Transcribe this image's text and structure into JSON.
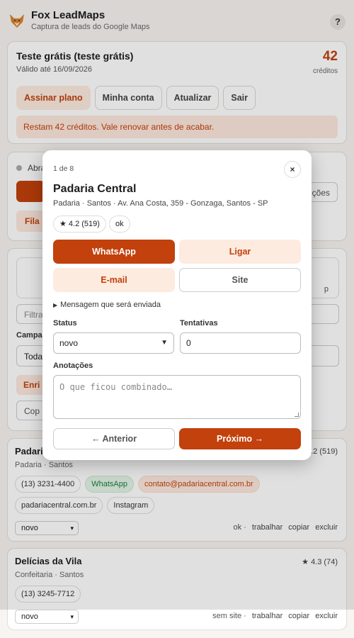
{
  "header": {
    "title": "Fox LeadMaps",
    "subtitle": "Captura de leads do Google Maps",
    "help_label": "?"
  },
  "plan": {
    "name": "Teste grátis (teste grátis)",
    "valid_until": "Válido até 16/09/2026",
    "credits": "42",
    "credits_label": "créditos",
    "buttons": {
      "subscribe": "Assinar plano",
      "account": "Minha conta",
      "refresh": "Atualizar",
      "logout": "Sair"
    },
    "warning": "Restam 42 créditos. Vale renovar antes de acabar."
  },
  "background": {
    "card2_label": "Abra",
    "options_label": "ções",
    "queue_label": "Fila",
    "box_partial": "p",
    "filter_placeholder": "Filtra",
    "campaign_label": "Campa",
    "select_value": "Toda",
    "enrich_label": "Enri",
    "copy_label": "Cop"
  },
  "leads": [
    {
      "name": "Padari",
      "rating": ".2 (519)",
      "category": "Padaria · Santos",
      "phone": "(13) 3231-4400",
      "whatsapp": "WhatsApp",
      "email": "contato@padariacentral.com.br",
      "site": "padariacentral.com.br",
      "instagram": "Instagram",
      "status": "novo",
      "flag": "ok ·",
      "actions": {
        "work": "trabalhar",
        "copy": "copiar",
        "delete": "excluir"
      }
    },
    {
      "name": "Delícias da Vila",
      "rating": "★ 4.3 (74)",
      "category": "Confeitaria · Santos",
      "phone": "(13) 3245-7712",
      "status": "novo",
      "flag": "sem site ·",
      "actions": {
        "work": "trabalhar",
        "copy": "copiar",
        "delete": "excluir"
      }
    }
  ],
  "modal": {
    "counter": "1 de 8",
    "close_label": "×",
    "title": "Padaria Central",
    "subtitle": "Padaria · Santos · Av. Ana Costa, 359 - Gonzaga, Santos - SP",
    "rating_chip": "★ 4.2 (519)",
    "status_chip": "ok",
    "buttons": {
      "whatsapp": "WhatsApp",
      "call": "Ligar",
      "email": "E-mail",
      "site": "Site"
    },
    "message_summary": "Mensagem que será enviada",
    "status_label": "Status",
    "status_value": "novo",
    "attempts_label": "Tentativas",
    "attempts_value": "0",
    "notes_label": "Anotações",
    "notes_placeholder": "O que ficou combinado…",
    "prev_label": "← Anterior",
    "next_label": "Próximo →"
  },
  "colors": {
    "accent": "#c2410c",
    "accent_soft": "#fdebe0",
    "whatsapp_green": "#1f7a3a"
  }
}
